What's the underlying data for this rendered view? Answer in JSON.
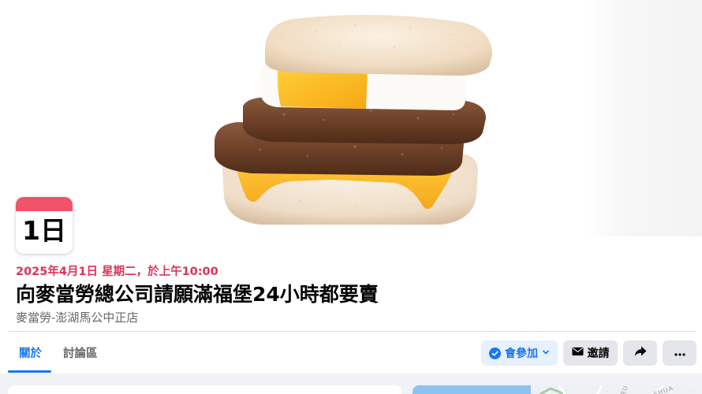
{
  "event": {
    "calendar_day": "1日",
    "date_text": "2025年4月1日 星期二，於上午10:00",
    "title": "向麥當勞總公司請願滿福堡24小時都要賣",
    "location": "麥當勞-澎湖馬公中正店"
  },
  "tabs": [
    {
      "label": "關於",
      "active": true
    },
    {
      "label": "討論區",
      "active": false
    }
  ],
  "actions": {
    "going_label": "會參加",
    "invite_label": "邀請"
  },
  "icons": {
    "going": "check-circle-icon",
    "going_dropdown": "chevron-down-icon",
    "invite": "envelope-icon",
    "share": "share-arrow-icon",
    "more": "more-dots-icon",
    "cover": "sausage-egg-muffin-photo"
  },
  "map": {
    "labels": [
      "RU",
      "SHUA"
    ]
  },
  "colors": {
    "accent_blue": "#1877f2",
    "date_red": "#e0325a",
    "calendar_header": "#f0526a"
  }
}
